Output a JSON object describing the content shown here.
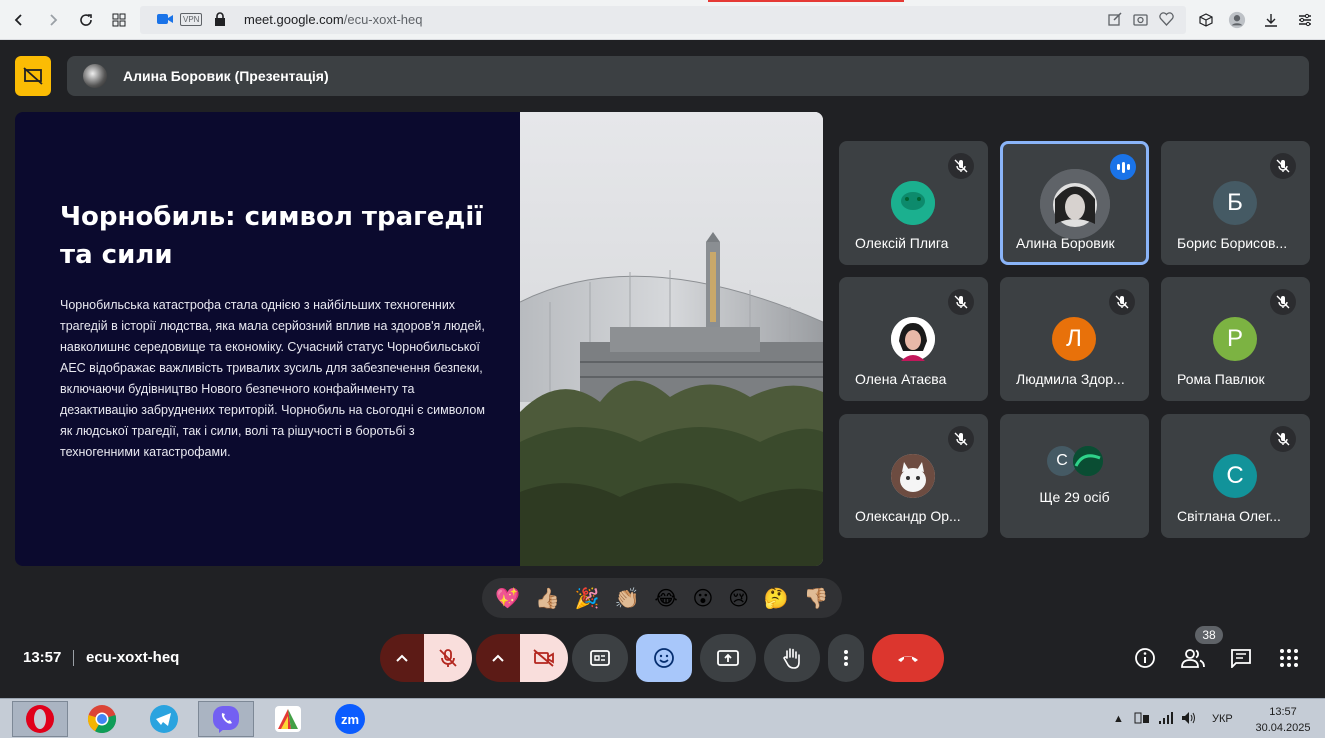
{
  "browser": {
    "url_host": "meet.google.com",
    "url_path": "/ecu-xoxt-heq",
    "vpn_label": "VPN"
  },
  "meeting": {
    "presenter_label": "Алина Боровик (Презентація)"
  },
  "slide": {
    "title": "Чорнобиль: символ трагедії та сили",
    "body": "Чорнобильська катастрофа стала однією з найбільших техногенних трагедій в історії людства, яка мала серйозний вплив на здоров'я людей, навколишнє середовище та економіку. Сучасний статус Чорнобильської АЕС відображає важливість тривалих зусиль для забезпечення безпеки, включаючи будівництво Нового безпечного конфайнменту та дезактивацію забруднених територій. Чорнобиль на сьогодні є символом як людської трагедії, так і сили, волі та рішучості в боротьбі з техногенними катастрофами."
  },
  "participants": [
    {
      "name": "Олексій Плига",
      "initial": "",
      "avatar_color": "#1bb08f",
      "muted": true
    },
    {
      "name": "Алина Боровик",
      "initial": "",
      "avatar_color": "#555555",
      "muted": false,
      "speaking": true
    },
    {
      "name": "Борис Борисов...",
      "initial": "Б",
      "avatar_color": "#455a64",
      "muted": true
    },
    {
      "name": "Олена Атаєва",
      "initial": "",
      "avatar_color": "#ffffff",
      "muted": true
    },
    {
      "name": "Людмила Здор...",
      "initial": "Л",
      "avatar_color": "#e8710a",
      "muted": true
    },
    {
      "name": "Рома Павлюк",
      "initial": "Р",
      "avatar_color": "#7cb342",
      "muted": true
    },
    {
      "name": "Олександр Ор...",
      "initial": "",
      "avatar_color": "#d7ccc8",
      "muted": true
    },
    {
      "name": "Ще 29 осіб",
      "initial": "С",
      "avatar_color": "#455a64"
    },
    {
      "name": "Світлана Олег...",
      "initial": "С",
      "avatar_color": "#12939a",
      "muted": true
    }
  ],
  "reactions": [
    "💖",
    "👍🏼",
    "🎉",
    "👏🏼",
    "😂",
    "😮",
    "😢",
    "🤔",
    "👎🏼"
  ],
  "footer": {
    "time": "13:57",
    "code": "ecu-xoxt-heq",
    "participants_count": "38"
  },
  "taskbar": {
    "lang": "УКР",
    "time": "13:57",
    "date": "30.04.2025"
  }
}
